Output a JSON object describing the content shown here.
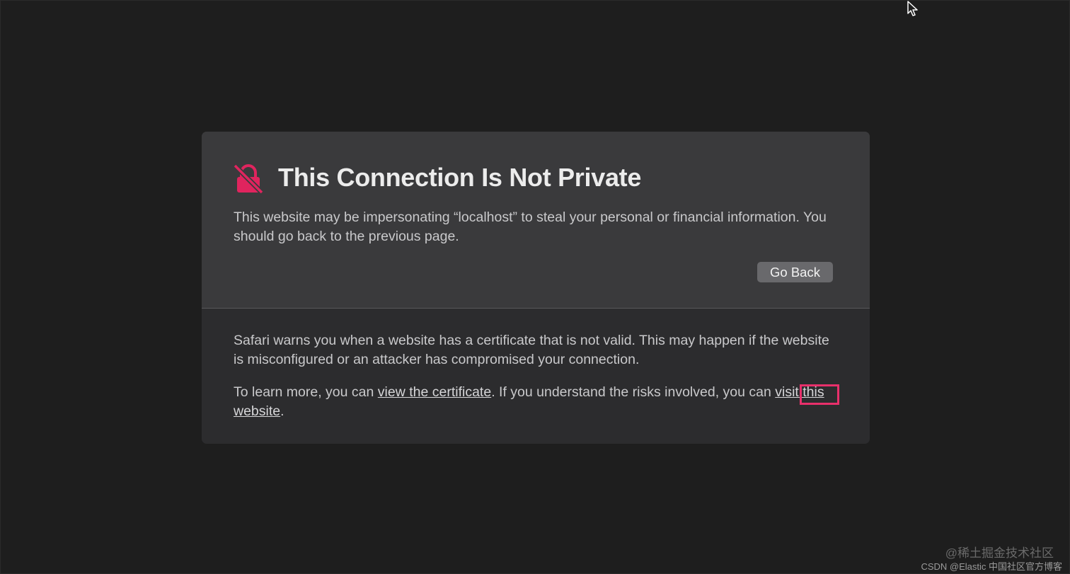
{
  "colors": {
    "background": "#1e1e1e",
    "card_top": "#3a3a3c",
    "card_bottom": "#2c2c2e",
    "lock_icon": "#e0245e",
    "highlight": "#e8306b",
    "button": "#69696c"
  },
  "dialog": {
    "icon": "lock-slash-icon",
    "title": "This Connection Is Not Private",
    "warning": "This website may be impersonating “localhost” to steal your personal or financial information. You should go back to the previous page.",
    "go_back_label": "Go Back",
    "info_paragraph": "Safari warns you when a website has a certificate that is not valid. This may happen if the website is misconfigured or an attacker has compromised your connection.",
    "learn_more": {
      "prefix": "To learn more, you can ",
      "certificate_link": "view the certificate",
      "middle": ". If you understand the risks involved, you can ",
      "visit_link": "visit this website",
      "suffix": "."
    }
  },
  "overlay": {
    "cursor_icon": "mouse-pointer-icon"
  },
  "watermark": {
    "line1": "@稀土掘金技术社区",
    "line2": "CSDN @Elastic 中国社区官方博客"
  }
}
